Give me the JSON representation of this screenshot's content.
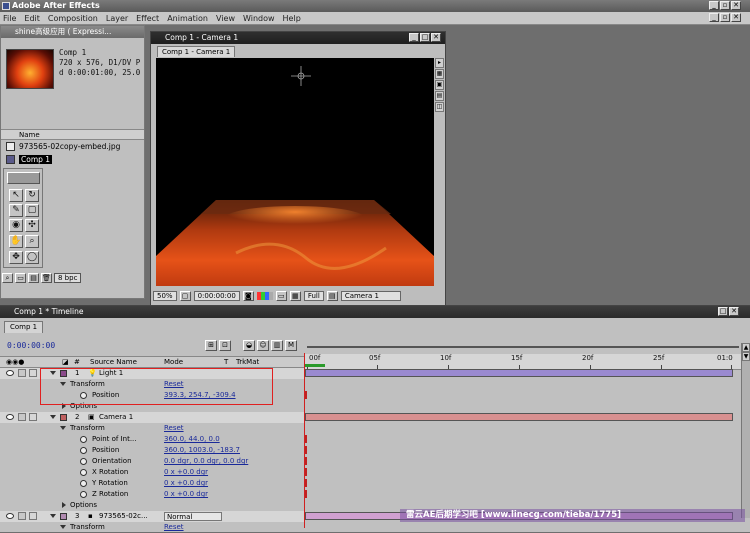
{
  "app": {
    "title": "Adobe After Effects"
  },
  "menu": [
    "File",
    "Edit",
    "Composition",
    "Layer",
    "Effect",
    "Animation",
    "View",
    "Window",
    "Help"
  ],
  "project": {
    "title": "shine高级应用 ( Expressi...",
    "comp_info": [
      "Comp 1",
      "720 x 576, D1/DV P",
      "d 0:00:01:00, 25.0"
    ],
    "list_header": "Name",
    "items": [
      {
        "name": "973565-02copy-embed.jpg",
        "selected": false
      },
      {
        "name": "Comp 1",
        "selected": true
      }
    ],
    "bpc": "8 bpc"
  },
  "comp": {
    "title": "Comp 1 - Camera 1",
    "tab": "Comp 1 - Camera 1",
    "zoom": "50%",
    "time": "0:00:00:00",
    "resolution": "Full",
    "view": "Camera 1"
  },
  "timeline": {
    "title": "Comp 1 * Timeline",
    "tab": "Comp 1",
    "current_time": "0:00:00:00",
    "headers": {
      "num": "#",
      "source": "Source Name",
      "mode": "Mode",
      "t": "T",
      "trkmat": "TrkMat"
    },
    "ruler": [
      "00f",
      "05f",
      "10f",
      "15f",
      "20f",
      "25f",
      "01:0"
    ],
    "layers": {
      "light": {
        "index": "1",
        "name": "Light 1",
        "transform": "Transform",
        "reset": "Reset",
        "position_label": "Position",
        "position": "393.3, 254.7, -309.4",
        "options": "Options"
      },
      "camera": {
        "index": "2",
        "name": "Camera 1",
        "transform": "Transform",
        "reset": "Reset",
        "props": [
          {
            "label": "Point of Int...",
            "value": "360.0, 44.0, 0.0"
          },
          {
            "label": "Position",
            "value": "360.0, 1003.0, -183.7"
          },
          {
            "label": "Orientation",
            "value": "0.0 dgr, 0.0 dgr, 0.0 dgr"
          },
          {
            "label": "X Rotation",
            "value": "0 x +0.0 dgr"
          },
          {
            "label": "Y Rotation",
            "value": "0 x +0.0 dgr"
          },
          {
            "label": "Z Rotation",
            "value": "0 x +0.0 dgr"
          }
        ],
        "options": "Options"
      },
      "image": {
        "index": "3",
        "name": "973565-02c...",
        "mode": "Normal",
        "transform": "Transform",
        "reset": "Reset"
      }
    }
  },
  "watermark": "雷云AE后期学习吧 [www.linecg.com/tieba/1775]"
}
